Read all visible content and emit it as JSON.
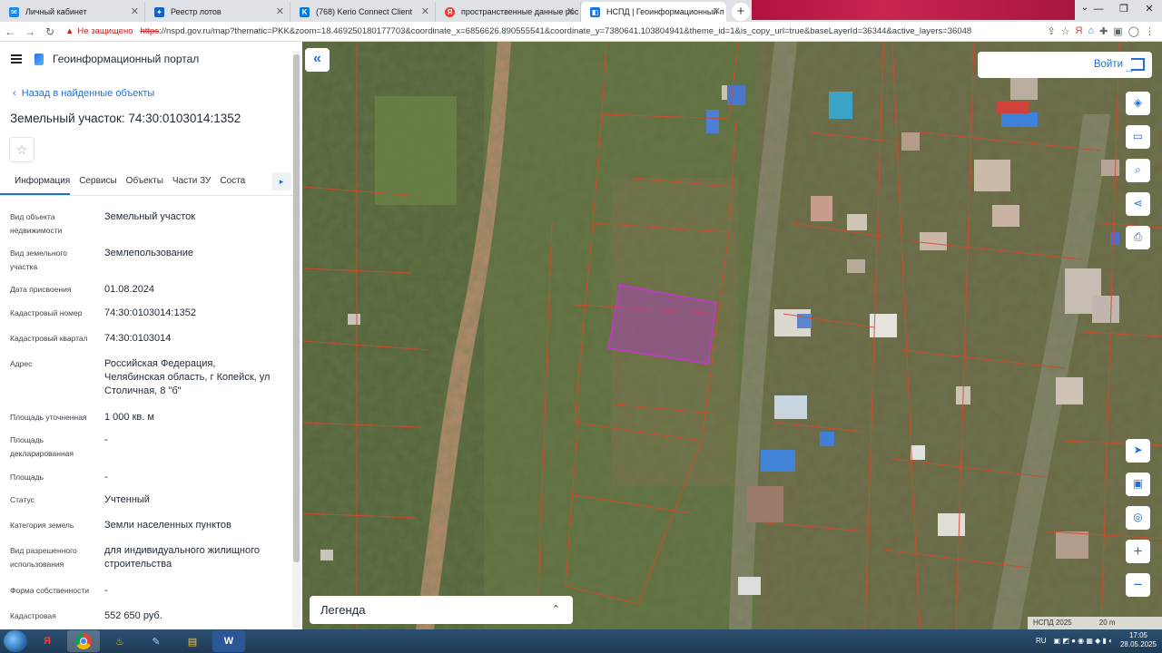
{
  "browser": {
    "tabs": [
      {
        "title": "Личный кабинет",
        "icon": "gosuslugi-icon",
        "color": "#1e88e5",
        "active": false
      },
      {
        "title": "Реестр лотов",
        "icon": "torgi-icon",
        "color": "#1565c0",
        "active": false
      },
      {
        "title": "(768) Kerio Connect Client",
        "icon": "kerio-icon",
        "color": "#0b79d0",
        "active": false
      },
      {
        "title": "пространственные данные рос",
        "icon": "yandex-icon",
        "color": "#e53935",
        "active": false
      },
      {
        "title": "НСПД | Геоинформационный п",
        "icon": "nspd-icon",
        "color": "#1a73e8",
        "active": true
      }
    ],
    "new_tab": "+",
    "security_warning": "Не защищено",
    "url_scheme": "https",
    "url_rest": "://nspd.gov.ru/map?thematic=PKK&zoom=18.469250180177703&coordinate_x=6856626.890555541&coordinate_y=7380641.103804941&theme_id=1&is_copy_url=true&baseLayerId=36344&active_layers=36048"
  },
  "panel": {
    "portal_title": "Геоинформационный портал",
    "back_link": "Назад в найденные объекты",
    "object_title": "Земельный участок: 74:30:0103014:1352",
    "tabs": [
      "Информация",
      "Сервисы",
      "Объекты",
      "Части ЗУ",
      "Соста"
    ],
    "properties": [
      {
        "key": "Вид объекта недвижимости",
        "value": "Земельный участок"
      },
      {
        "key": "Вид земельного участка",
        "value": "Землепользование"
      },
      {
        "key": "Дата присвоения",
        "value": "01.08.2024"
      },
      {
        "key": "Кадастровый номер",
        "value": "74:30:0103014:1352"
      },
      {
        "key": "Кадастровый квартал",
        "value": "74:30:0103014"
      },
      {
        "key": "Адрес",
        "value": "Российская Федерация, Челябинская область, г Копейск, ул Столичная, 8 \"б\""
      },
      {
        "key": "Площадь уточненная",
        "value": "1 000 кв. м"
      },
      {
        "key": "Площадь декларированная",
        "value": "-"
      },
      {
        "key": "Площадь",
        "value": "-"
      },
      {
        "key": "Статус",
        "value": "Учтенный"
      },
      {
        "key": "Категория земель",
        "value": "Земли населенных пунктов"
      },
      {
        "key": "Вид разрешенного использования",
        "value": "для индивидуального жилищного строительства"
      },
      {
        "key": "Форма собственности",
        "value": "-"
      },
      {
        "key": "Кадастровая",
        "value": "552 650 руб."
      }
    ]
  },
  "map": {
    "login_label": "Войти",
    "legend_label": "Легенда",
    "attribution": "НСПД 2025",
    "scale_label": "20 m",
    "highlight_color": "#c238c9",
    "parcel_line_color": "#d9472b"
  },
  "taskbar": {
    "language": "RU",
    "time": "17:05",
    "date": "28.05.2025"
  }
}
